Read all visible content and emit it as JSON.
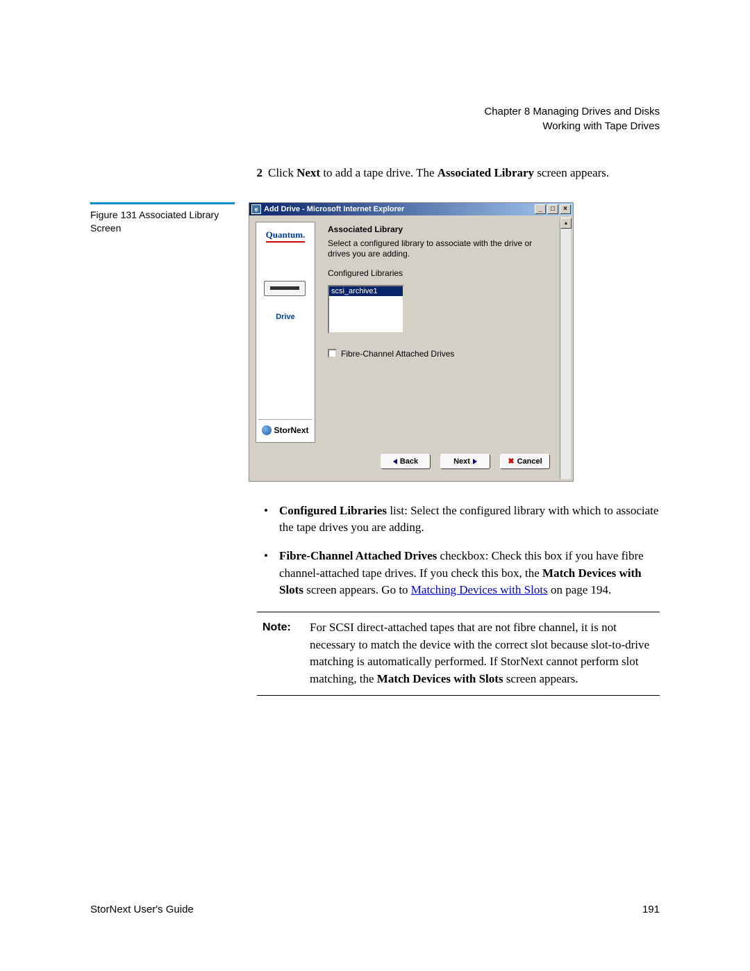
{
  "header": {
    "chapter": "Chapter 8  Managing Drives and Disks",
    "section": "Working with Tape Drives"
  },
  "step": {
    "num": "2",
    "pre": "Click ",
    "bold1": "Next",
    "mid": " to add a tape drive. The ",
    "bold2": "Associated Library",
    "post": " screen appears."
  },
  "figure": {
    "label": "Figure 131  Associated Library Screen"
  },
  "ie": {
    "title": "Add Drive - Microsoft Internet Explorer",
    "sidebar": {
      "brand": "Quantum.",
      "drive_label": "Drive",
      "product": "StorNext"
    },
    "content": {
      "heading": "Associated Library",
      "description": "Select a configured library to associate with the drive or drives you are adding.",
      "list_label": "Configured Libraries",
      "list_item": "scsi_archive1",
      "checkbox_label": "Fibre-Channel Attached Drives"
    },
    "buttons": {
      "back": "Back",
      "next": "Next",
      "cancel": "Cancel"
    }
  },
  "bullets": {
    "b1": {
      "bold": "Configured Libraries",
      "mid": " list: Select the configured library with which to associate the tape drives you are adding."
    },
    "b2": {
      "bold1": "Fibre-Channel Attached Drives",
      "mid1": " checkbox: Check this box if you have fibre channel-attached tape drives. If you check this box, the ",
      "bold2": "Match Devices with Slots",
      "mid2": " screen appears. Go to ",
      "link": "Matching Devices with Slots",
      "post": " on page  194."
    }
  },
  "note": {
    "label": "Note:",
    "pre": "For SCSI direct-attached tapes that are not fibre channel, it is not necessary to match the device with the correct slot because slot-to-drive matching is automatically performed. If StorNext cannot perform slot matching, the ",
    "bold": "Match Devices with Slots",
    "post": " screen appears."
  },
  "footer": {
    "left": "StorNext User's Guide",
    "right": "191"
  }
}
